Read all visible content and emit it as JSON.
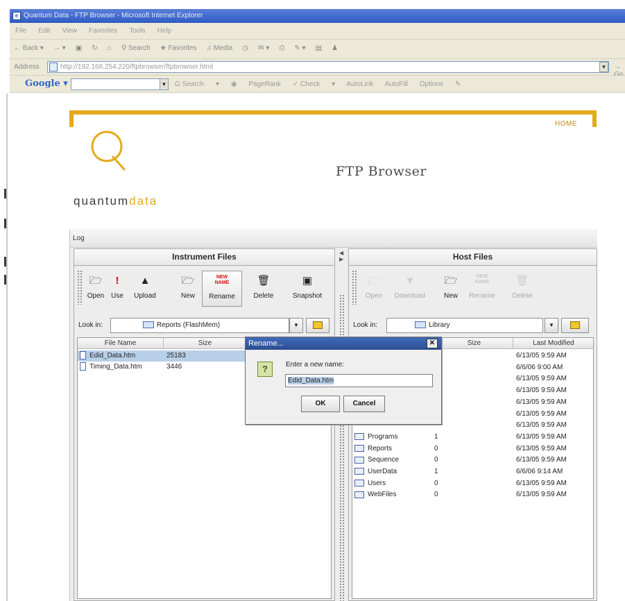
{
  "browser": {
    "title": "Quantum Data - FTP Browser - Microsoft Internet Explorer",
    "menu": [
      "File",
      "Edit",
      "View",
      "Favorites",
      "Tools",
      "Help"
    ],
    "toolbar": [
      "Back",
      "Search",
      "Favorites",
      "Media"
    ],
    "address_label": "Address",
    "address_value": "http://192.168.254.220/ftpbrowser/ftpbrowser.html",
    "address_go": "Go",
    "google": {
      "logo": "Google",
      "search_label": "Search",
      "tools": [
        "PageRank",
        "Check",
        "AutoLink",
        "AutoFill",
        "Options"
      ]
    }
  },
  "page": {
    "home_link": "HOME",
    "logo": {
      "quantum": "quantum",
      "data": "data"
    },
    "title": "FTP Browser"
  },
  "applet": {
    "menu_log": "Log",
    "instrument": {
      "title": "Instrument Files",
      "buttons": [
        {
          "label": "Open",
          "icon": "open-icon"
        },
        {
          "label": "Use",
          "icon": "use-icon"
        },
        {
          "label": "Upload",
          "icon": "upload-icon"
        },
        {
          "label": "New",
          "icon": "new-folder-icon"
        },
        {
          "label": "Rename",
          "icon": "rename-icon"
        },
        {
          "label": "Delete",
          "icon": "delete-icon"
        },
        {
          "label": "Snapshot",
          "icon": "snapshot-icon"
        }
      ],
      "look_in_label": "Look in:",
      "look_in_value": "Reports (FlashMem)",
      "columns": [
        "File Name",
        "Size"
      ],
      "files": [
        {
          "name": "Edid_Data.htm",
          "size": "25183",
          "selected": true
        },
        {
          "name": "Timing_Data.htm",
          "size": "3446",
          "selected": false
        }
      ]
    },
    "host": {
      "title": "Host Files",
      "buttons": [
        {
          "label": "Open",
          "icon": "open-icon"
        },
        {
          "label": "Download",
          "icon": "download-icon"
        },
        {
          "label": "New",
          "icon": "new-folder-icon"
        },
        {
          "label": "Rename",
          "icon": "rename-icon"
        },
        {
          "label": "Delete",
          "icon": "delete-icon"
        }
      ],
      "look_in_label": "Look in:",
      "look_in_value": "Library",
      "columns": [
        "Size",
        "Last Modified"
      ],
      "files": [
        {
          "name": "",
          "size": "",
          "modified": "6/13/05 9:59 AM"
        },
        {
          "name": "",
          "size": "",
          "modified": "6/6/06 9:00 AM"
        },
        {
          "name": "",
          "size": "",
          "modified": "6/13/05 9:59 AM"
        },
        {
          "name": "",
          "size": "",
          "modified": "6/13/05 9:59 AM"
        },
        {
          "name": "",
          "size": "",
          "modified": "6/13/05 9:59 AM"
        },
        {
          "name": "",
          "size": "",
          "modified": "6/13/05 9:59 AM"
        },
        {
          "name": "",
          "size": "",
          "modified": "6/13/05 9:59 AM"
        },
        {
          "name": "Programs",
          "size": "1",
          "modified": "6/13/05 9:59 AM"
        },
        {
          "name": "Reports",
          "size": "0",
          "modified": "6/13/05 9:59 AM"
        },
        {
          "name": "Sequence",
          "size": "0",
          "modified": "6/13/05 9:59 AM"
        },
        {
          "name": "UserData",
          "size": "1",
          "modified": "6/6/06 9:14 AM"
        },
        {
          "name": "Users",
          "size": "0",
          "modified": "6/13/05 9:59 AM"
        },
        {
          "name": "WebFiles",
          "size": "0",
          "modified": "6/13/05 9:59 AM"
        }
      ]
    },
    "dialog": {
      "title": "Rename...",
      "prompt": "Enter a new name:",
      "value": "Edid_Data.htm",
      "ok": "OK",
      "cancel": "Cancel"
    }
  }
}
